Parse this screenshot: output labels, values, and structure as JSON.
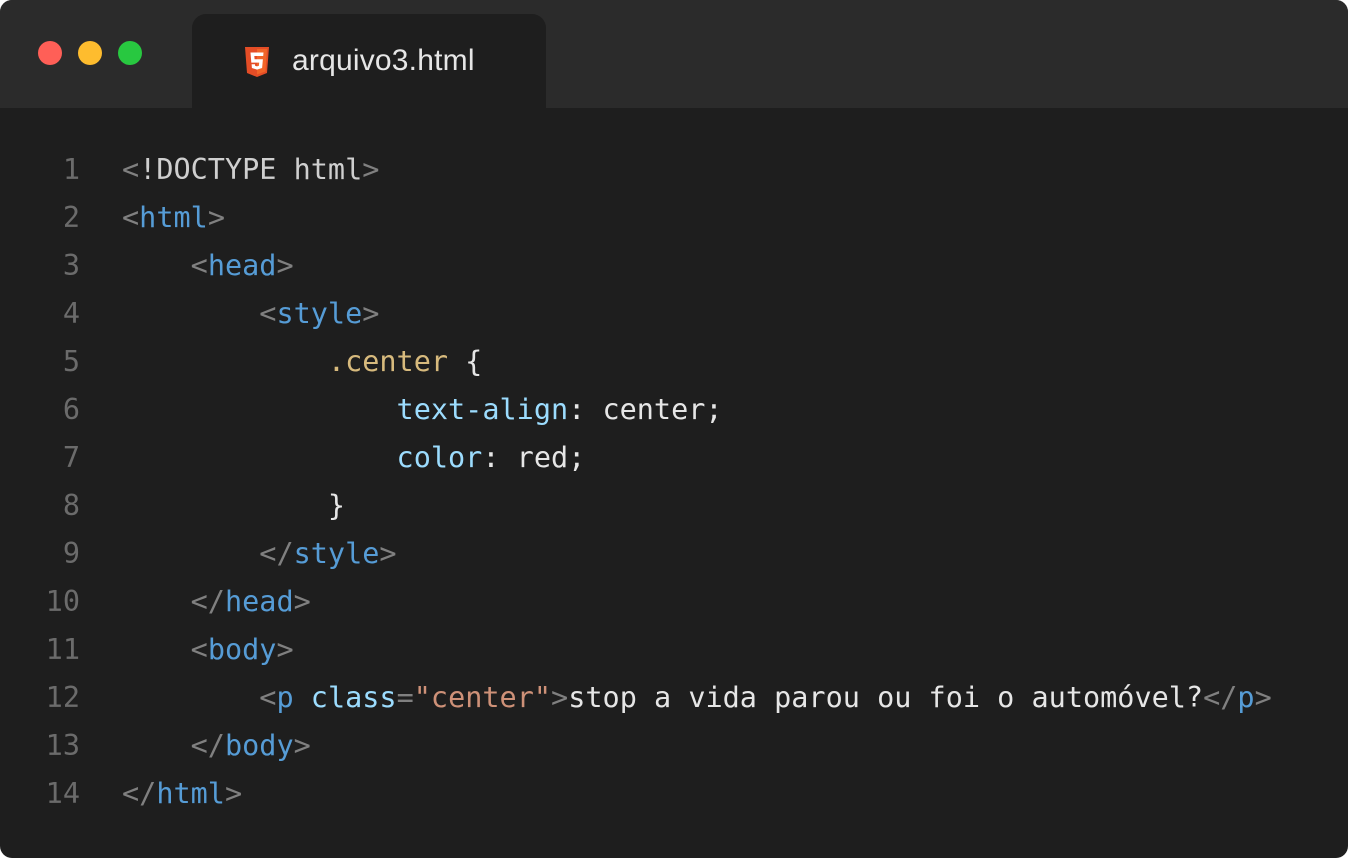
{
  "tab": {
    "filename": "arquivo3.html",
    "icon": "html5-icon"
  },
  "colors": {
    "window_bg": "#1e1e1e",
    "titlebar_bg": "#2b2b2b",
    "close": "#ff5f57",
    "minimize": "#febc2e",
    "maximize": "#28c840",
    "html5_orange": "#e44d26"
  },
  "code": {
    "lines": [
      {
        "n": "1",
        "tokens": [
          [
            "c-punct",
            "<"
          ],
          [
            "c-doctype",
            "!DOCTYPE html"
          ],
          [
            "c-punct",
            ">"
          ]
        ]
      },
      {
        "n": "2",
        "tokens": [
          [
            "c-punct",
            "<"
          ],
          [
            "c-tag",
            "html"
          ],
          [
            "c-punct",
            ">"
          ]
        ]
      },
      {
        "n": "3",
        "tokens": [
          [
            "c-text",
            "    "
          ],
          [
            "c-punct",
            "<"
          ],
          [
            "c-tag",
            "head"
          ],
          [
            "c-punct",
            ">"
          ]
        ]
      },
      {
        "n": "4",
        "tokens": [
          [
            "c-text",
            "        "
          ],
          [
            "c-punct",
            "<"
          ],
          [
            "c-tag",
            "style"
          ],
          [
            "c-punct",
            ">"
          ]
        ]
      },
      {
        "n": "5",
        "tokens": [
          [
            "c-text",
            "            "
          ],
          [
            "c-sel",
            ".center"
          ],
          [
            "c-brace",
            " {"
          ]
        ]
      },
      {
        "n": "6",
        "tokens": [
          [
            "c-text",
            "                "
          ],
          [
            "c-prop",
            "text-align"
          ],
          [
            "c-text",
            ": center;"
          ]
        ]
      },
      {
        "n": "7",
        "tokens": [
          [
            "c-text",
            "                "
          ],
          [
            "c-prop",
            "color"
          ],
          [
            "c-text",
            ": red;"
          ]
        ]
      },
      {
        "n": "8",
        "tokens": [
          [
            "c-text",
            "            "
          ],
          [
            "c-brace",
            "}"
          ]
        ]
      },
      {
        "n": "9",
        "tokens": [
          [
            "c-text",
            "        "
          ],
          [
            "c-punct",
            "</"
          ],
          [
            "c-tag",
            "style"
          ],
          [
            "c-punct",
            ">"
          ]
        ]
      },
      {
        "n": "10",
        "tokens": [
          [
            "c-text",
            "    "
          ],
          [
            "c-punct",
            "</"
          ],
          [
            "c-tag",
            "head"
          ],
          [
            "c-punct",
            ">"
          ]
        ]
      },
      {
        "n": "11",
        "tokens": [
          [
            "c-text",
            "    "
          ],
          [
            "c-punct",
            "<"
          ],
          [
            "c-tag",
            "body"
          ],
          [
            "c-punct",
            ">"
          ]
        ]
      },
      {
        "n": "12",
        "tokens": [
          [
            "c-text",
            "        "
          ],
          [
            "c-punct",
            "<"
          ],
          [
            "c-tag",
            "p"
          ],
          [
            "c-text",
            " "
          ],
          [
            "c-attr",
            "class"
          ],
          [
            "c-punct",
            "="
          ],
          [
            "c-str",
            "\"center\""
          ],
          [
            "c-punct",
            ">"
          ],
          [
            "c-text",
            "stop a vida parou ou foi o automóvel?"
          ],
          [
            "c-punct",
            "</"
          ],
          [
            "c-tag",
            "p"
          ],
          [
            "c-punct",
            ">"
          ]
        ]
      },
      {
        "n": "13",
        "tokens": [
          [
            "c-text",
            "    "
          ],
          [
            "c-punct",
            "</"
          ],
          [
            "c-tag",
            "body"
          ],
          [
            "c-punct",
            ">"
          ]
        ]
      },
      {
        "n": "14",
        "tokens": [
          [
            "c-punct",
            "</"
          ],
          [
            "c-tag",
            "html"
          ],
          [
            "c-punct",
            ">"
          ]
        ]
      }
    ]
  }
}
